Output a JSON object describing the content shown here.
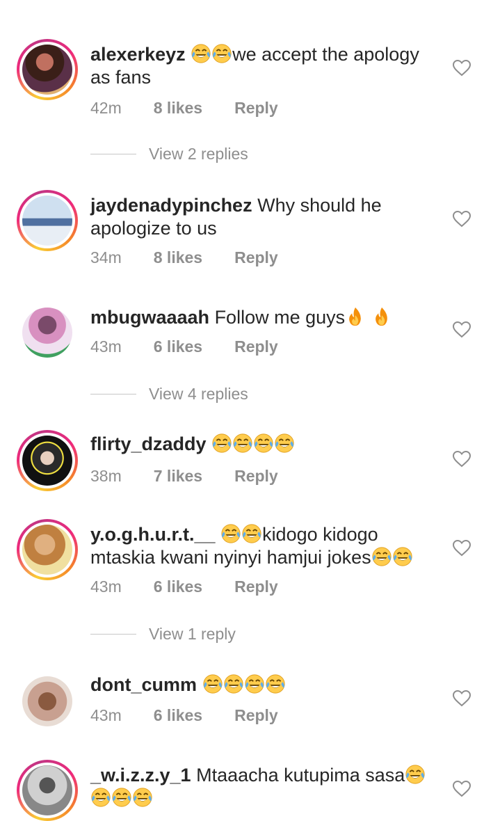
{
  "comments": [
    {
      "username": "alexerkeyz",
      "text_pre": "",
      "emojis_before": 2,
      "text": "we accept the apology as fans",
      "time": "42m",
      "likes": "8 likes",
      "reply": "Reply"
    },
    {
      "username": "jaydenadypinchez",
      "text": "Why should he apologize to us",
      "time": "34m",
      "likes": "8 likes",
      "reply": "Reply"
    },
    {
      "username": "mbugwaaaah",
      "text": "Follow me guys",
      "time": "43m",
      "likes": "6 likes",
      "reply": "Reply"
    },
    {
      "username": "flirty_dzaddy",
      "text": "",
      "time": "38m",
      "likes": "7 likes",
      "reply": "Reply"
    },
    {
      "username": "y.o.g.h.u.r.t.__",
      "text": "kidogo kidogo mtaskia kwani nyinyi hamjui jokes",
      "time": "43m",
      "likes": "6 likes",
      "reply": "Reply"
    },
    {
      "username": "dont_cumm",
      "text": "",
      "time": "43m",
      "likes": "6 likes",
      "reply": "Reply"
    },
    {
      "username": "_w.i.z.z.y_1",
      "text": "Mtaaacha kutupima sasa",
      "time": "",
      "likes": "",
      "reply": ""
    }
  ],
  "view_replies": [
    {
      "label": "View 2 replies"
    },
    {
      "label": "View 4 replies"
    },
    {
      "label": "View 1 reply"
    }
  ],
  "icons": {
    "like": "heart-outline-icon",
    "laugh": "face-with-tears-of-joy-emoji",
    "fire": "fire-emoji"
  }
}
